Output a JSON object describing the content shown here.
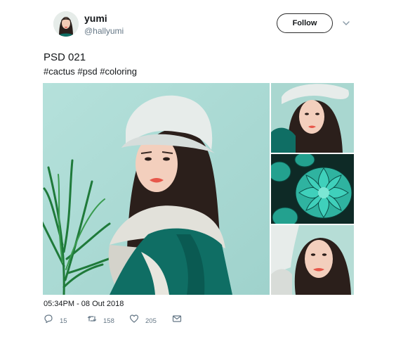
{
  "user": {
    "name": "yumi",
    "handle": "@hallyumi"
  },
  "follow_label": "Follow",
  "tweet": {
    "title": "PSD 021",
    "hashtags": "#cactus #psd #coloring",
    "timestamp": "05:34PM - 08 Out 2018"
  },
  "stats": {
    "replies": "15",
    "retweets": "158",
    "likes": "205"
  },
  "icons": {
    "reply": "reply-icon",
    "retweet": "retweet-icon",
    "like": "heart-icon",
    "message": "envelope-icon",
    "more": "chevron-down-icon"
  },
  "colors": {
    "accent": "#1da1f2",
    "muted": "#657786",
    "text": "#14171a",
    "photo_bg": "#a9d8d3",
    "teal": "#0f6e64"
  }
}
